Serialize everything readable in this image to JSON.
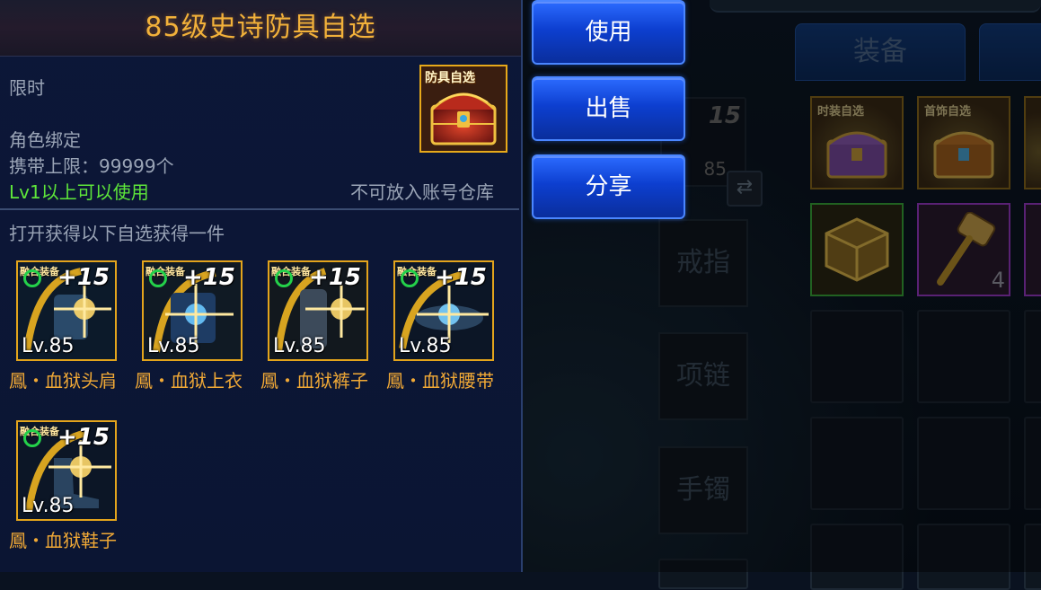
{
  "panel": {
    "title": "85级史诗防具自选",
    "limited": "限时",
    "bind": "角色绑定",
    "carry_limit": "携带上限：99999个",
    "usable_level": "Lv1以上可以使用",
    "storage_note": "不可放入账号仓库",
    "box_icon_label": "防具自选",
    "rewards_heading": "打开获得以下自选获得一件"
  },
  "rewards": [
    {
      "name": "鳳・血狱头肩",
      "level": "Lv.85",
      "enhance": "+15",
      "tag": "融合装备"
    },
    {
      "name": "鳳・血狱上衣",
      "level": "Lv.85",
      "enhance": "+15",
      "tag": "融合装备"
    },
    {
      "name": "鳳・血狱裤子",
      "level": "Lv.85",
      "enhance": "+15",
      "tag": "融合装备"
    },
    {
      "name": "鳳・血狱腰带",
      "level": "Lv.85",
      "enhance": "+15",
      "tag": "融合装备"
    },
    {
      "name": "鳳・血狱鞋子",
      "level": "Lv.85",
      "enhance": "+15",
      "tag": "融合装备"
    }
  ],
  "actions": {
    "use": "使用",
    "sell": "出售",
    "share": "分享"
  },
  "background": {
    "tab_equipment": "装备",
    "slot_ring": "戒指",
    "slot_necklace": "项链",
    "slot_bracelet": "手镯",
    "partial_level": "85",
    "partial_enhance": "15",
    "chest_fashion": "时装自选",
    "chest_accessory": "首饰自选",
    "hammer_count": "4"
  },
  "colors": {
    "title": "#f2b13a",
    "item_name": "#f1a936",
    "green_text": "#5ee63a",
    "item_border": "#e3a41c",
    "button": "#0d3fd0"
  }
}
